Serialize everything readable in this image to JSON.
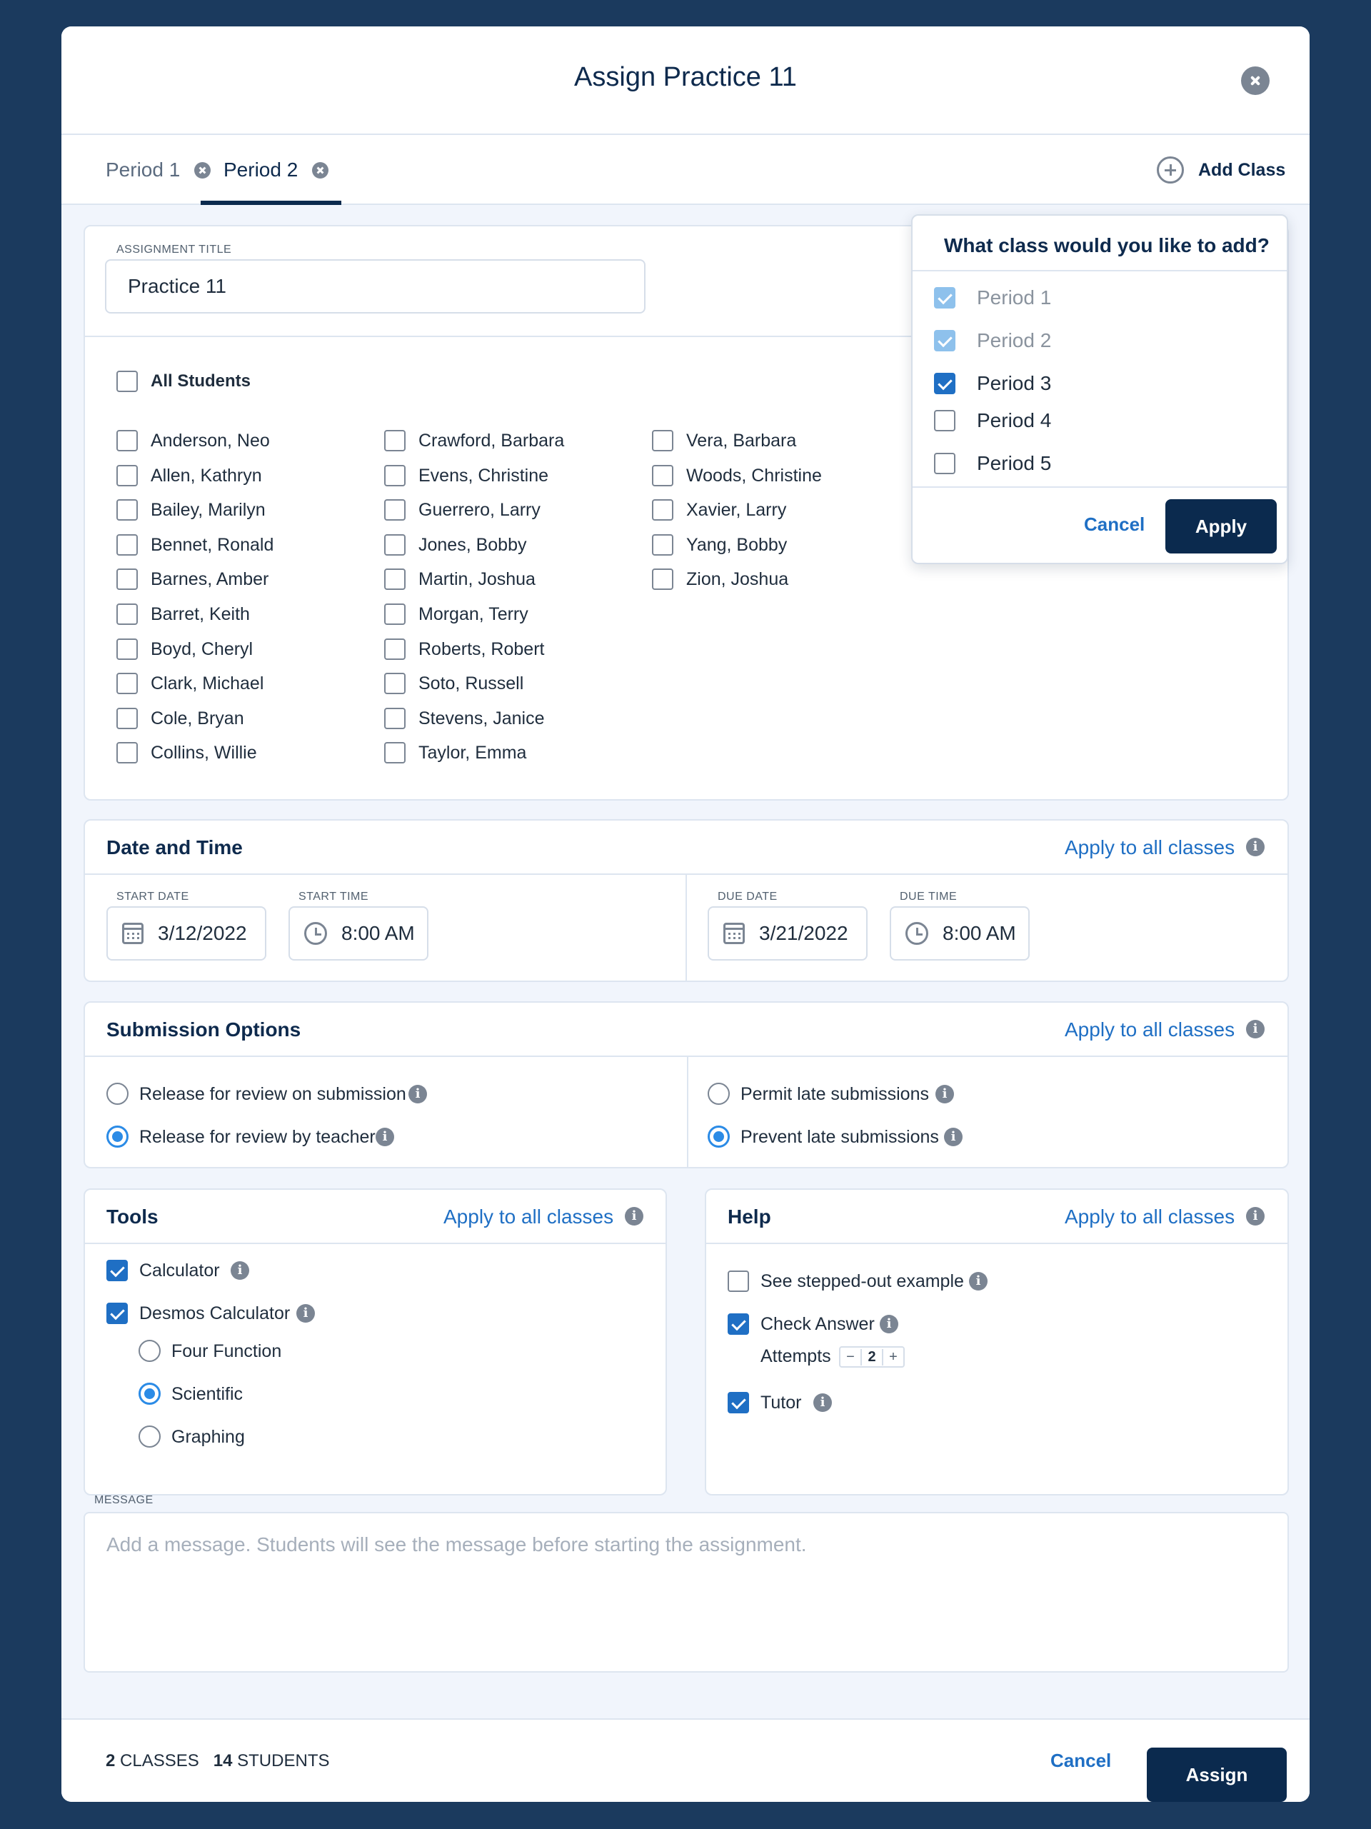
{
  "modal": {
    "title": "Assign Practice 11"
  },
  "tabs": [
    {
      "label": "Period 1"
    },
    {
      "label": "Period 2"
    }
  ],
  "add_class": {
    "label": "Add Class"
  },
  "assignment": {
    "label": "ASSIGNMENT TITLE",
    "value": "Practice 11"
  },
  "students": {
    "all_label": "All Students",
    "col1": [
      "Anderson, Neo",
      "Allen, Kathryn",
      "Bailey, Marilyn",
      "Bennet, Ronald",
      "Barnes, Amber",
      "Barret, Keith",
      "Boyd, Cheryl",
      "Clark, Michael",
      "Cole, Bryan",
      "Collins, Willie"
    ],
    "col2": [
      "Crawford, Barbara",
      "Evens, Christine",
      "Guerrero, Larry",
      "Jones, Bobby",
      "Martin, Joshua",
      "Morgan, Terry",
      "Roberts, Robert",
      "Soto, Russell",
      "Stevens, Janice",
      "Taylor, Emma"
    ],
    "col3": [
      "Vera, Barbara",
      "Woods, Christine",
      "Xavier, Larry",
      "Yang, Bobby",
      "Zion, Joshua"
    ]
  },
  "popup": {
    "title": "What class would you like to add?",
    "options": [
      {
        "label": "Period 1",
        "state": "disabled-checked"
      },
      {
        "label": "Period 2",
        "state": "disabled-checked"
      },
      {
        "label": "Period 3",
        "state": "checked"
      },
      {
        "label": "Period 4",
        "state": "unchecked"
      },
      {
        "label": "Period 5",
        "state": "unchecked"
      }
    ],
    "cancel": "Cancel",
    "apply": "Apply"
  },
  "apply_all_label": "Apply to all classes",
  "date_time": {
    "title": "Date and Time",
    "start_date_label": "START DATE",
    "start_date": "3/12/2022",
    "start_time_label": "START TIME",
    "start_time": "8:00 AM",
    "due_date_label": "DUE DATE",
    "due_date": "3/21/2022",
    "due_time_label": "DUE TIME",
    "due_time": "8:00 AM"
  },
  "submission": {
    "title": "Submission Options",
    "release_on_submission": "Release for review on submission",
    "release_by_teacher": "Release for review by teacher",
    "permit_late": "Permit late submissions",
    "prevent_late": "Prevent late submissions",
    "selected_release": "Release for review by teacher",
    "selected_late": "Prevent late submissions"
  },
  "tools": {
    "title": "Tools",
    "calculator": "Calculator",
    "desmos": "Desmos Calculator",
    "four_function": "Four Function",
    "scientific": "Scientific",
    "graphing": "Graphing",
    "selected_desmos_mode": "Scientific"
  },
  "help": {
    "title": "Help",
    "stepped_out": "See stepped-out example",
    "check_answer": "Check Answer",
    "attempts_label": "Attempts",
    "attempts_value": "2",
    "tutor": "Tutor"
  },
  "message": {
    "label": "MESSAGE",
    "placeholder": "Add a message. Students will see the message before starting the assignment."
  },
  "footer": {
    "classes_count": "2",
    "classes_label": "CLASSES",
    "students_count": "14",
    "students_label": "STUDENTS",
    "cancel": "Cancel",
    "assign": "Assign"
  },
  "colors": {
    "page_bg": "#1b3a5e",
    "primary": "#0b2a4e",
    "link": "#1f6fc4",
    "check": "#1f6fc4"
  }
}
